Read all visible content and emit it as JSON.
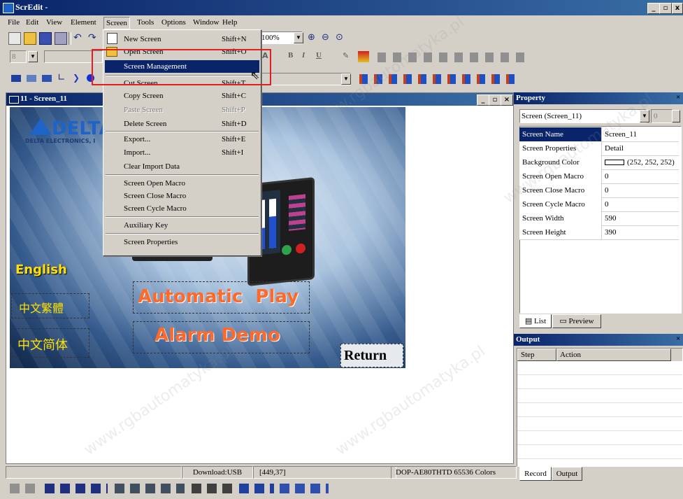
{
  "window": {
    "title": "ScrEdit -"
  },
  "menubar": [
    "File",
    "Edit",
    "View",
    "Element",
    "Screen",
    "Tools",
    "Options",
    "Window",
    "Help"
  ],
  "zoom": "100%",
  "font_size": "8",
  "screen_menu": {
    "items": [
      {
        "label": "New Screen",
        "shortcut": "Shift+N",
        "state": "normal"
      },
      {
        "label": "Open Screen",
        "shortcut": "Shift+O",
        "state": "normal"
      },
      {
        "label": "Screen Management",
        "shortcut": "",
        "state": "highlighted"
      },
      {
        "label": "Cut Screen",
        "shortcut": "Shift+T",
        "state": "normal"
      },
      {
        "label": "Copy Screen",
        "shortcut": "Shift+C",
        "state": "normal"
      },
      {
        "label": "Paste Screen",
        "shortcut": "Shift+P",
        "state": "disabled"
      },
      {
        "label": "Delete Screen",
        "shortcut": "Shift+D",
        "state": "normal"
      },
      {
        "label": "Export...",
        "shortcut": "Shift+E",
        "state": "normal"
      },
      {
        "label": "Import...",
        "shortcut": "Shift+I",
        "state": "normal"
      },
      {
        "label": "Clear Import Data",
        "shortcut": "",
        "state": "normal"
      },
      {
        "label": "Screen Open Macro",
        "shortcut": "",
        "state": "normal"
      },
      {
        "label": "Screen Close Macro",
        "shortcut": "",
        "state": "normal"
      },
      {
        "label": "Screen Cycle Macro",
        "shortcut": "",
        "state": "normal"
      },
      {
        "label": "Auxiliary Key",
        "shortcut": "",
        "state": "normal"
      },
      {
        "label": "Screen Properties",
        "shortcut": "",
        "state": "normal"
      }
    ]
  },
  "child_window": {
    "title": "11 - Screen_11"
  },
  "canvas": {
    "logo_text": "DELTA",
    "logo_subtext": "DELTA ELECTRONICS, I",
    "lang_english": "English",
    "lang_traditional": "中文繁體",
    "lang_simplified": "中文简体",
    "btn_auto": "Automatic  Play",
    "btn_alarm": "Alarm Demo",
    "btn_return": "Return"
  },
  "property": {
    "title": "Property",
    "selector": "Screen (Screen_11)",
    "spin_value": "0",
    "rows": [
      {
        "key": "Screen Name",
        "value": "Screen_11"
      },
      {
        "key": "Screen Properties",
        "value": "Detail"
      },
      {
        "key": "Background Color",
        "value": "(252, 252, 252)"
      },
      {
        "key": "Screen Open Macro",
        "value": "0"
      },
      {
        "key": "Screen Close Macro",
        "value": "0"
      },
      {
        "key": "Screen Cycle Macro",
        "value": "0"
      },
      {
        "key": "Screen Width",
        "value": "590"
      },
      {
        "key": "Screen Height",
        "value": "390"
      }
    ],
    "tab_list": "List",
    "tab_preview": "Preview"
  },
  "output": {
    "title": "Output",
    "col_step": "Step",
    "col_action": "Action",
    "tab_record": "Record",
    "tab_output": "Output"
  },
  "status": {
    "download": "Download:USB",
    "coords": "[449,37]",
    "model": "DOP-AE80THTD 65536 Colors"
  },
  "colors": {
    "accent": "#0a246a",
    "orange": "#ff6a2a",
    "yellow": "#ffe000",
    "highlight_box": "#e02020"
  },
  "watermark": "www.rgbautomatyka.pl"
}
